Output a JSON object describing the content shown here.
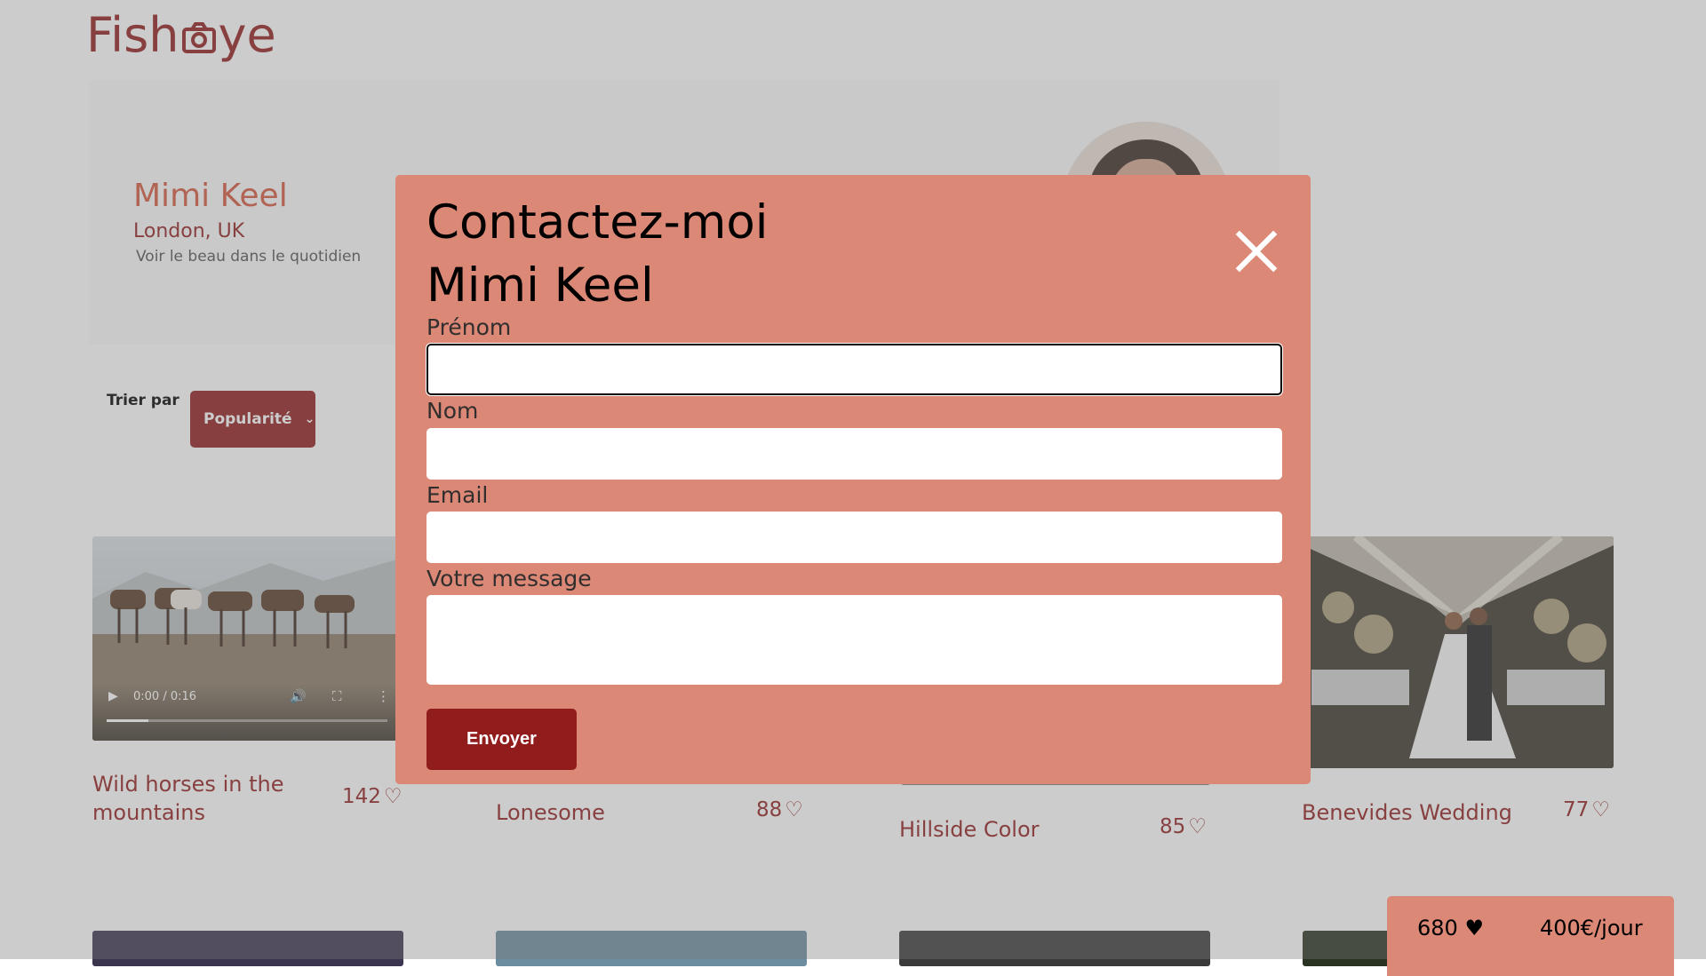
{
  "logo": "FishEye",
  "photographer": {
    "name": "Mimi Keel",
    "location": "London, UK",
    "tagline": "Voir le beau dans le quotidien"
  },
  "sort": {
    "label": "Trier par",
    "selected": "Popularité"
  },
  "gallery": [
    {
      "title": "Wild horses in the mountains",
      "likes": "142",
      "type": "video",
      "time": "0:00 / 0:16"
    },
    {
      "title": "Lonesome",
      "likes": "88",
      "type": "image"
    },
    {
      "title": "Hillside Color",
      "likes": "85",
      "type": "image"
    },
    {
      "title": "Benevides Wedding",
      "likes": "77",
      "type": "image"
    }
  ],
  "counter": {
    "likes_total": "680",
    "price": "400€/jour"
  },
  "modal": {
    "title_line1": "Contactez-moi",
    "title_line2": "Mimi Keel",
    "fields": [
      {
        "label": "Prénom",
        "value": ""
      },
      {
        "label": "Nom",
        "value": ""
      },
      {
        "label": "Email",
        "value": ""
      },
      {
        "label": "Votre message",
        "value": ""
      }
    ],
    "submit": "Envoyer"
  },
  "colors": {
    "brand": "#901c1c",
    "modal_bg": "#db8876",
    "accent": "#d3573c"
  }
}
